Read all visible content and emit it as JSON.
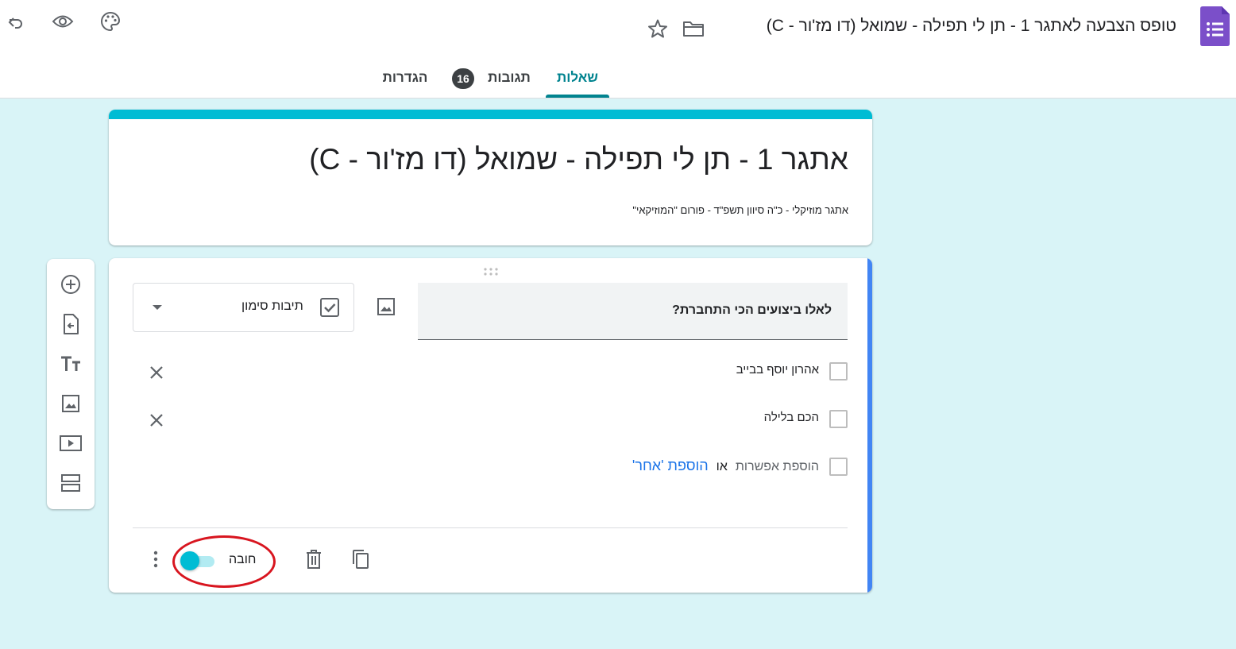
{
  "topbar": {
    "form_title": "טופס הצבעה לאתגר 1 - תן לי תפילה - שמואל (דו מז'ור - C)",
    "icons": [
      "undo-icon",
      "eye-icon",
      "palette-icon",
      "star-icon",
      "folder-icon",
      "forms-app-icon"
    ]
  },
  "tabs": [
    {
      "label": "שאלות",
      "active": true
    },
    {
      "label": "תגובות",
      "badge": "16"
    },
    {
      "label": "הגדרות"
    }
  ],
  "header": {
    "title": "אתגר 1 - תן לי תפילה - שמואל (דו מז'ור - C)",
    "description": "אתגר מוזיקלי - כ\"ה סיוון תשפ\"ד - פורום \"המוזיקאי\""
  },
  "side_toolbar": [
    "add-question-icon",
    "import-questions-icon",
    "add-title-icon",
    "add-image-icon",
    "add-video-icon",
    "add-section-icon"
  ],
  "question": {
    "title": "לאלו ביצועים הכי התחברת?",
    "type_label": "תיבות סימון",
    "options": [
      "אהרון יוסף בבייב",
      "הכם בלילה"
    ],
    "add_option_label": "הוספת אפשרות",
    "or_label": "או",
    "add_other_label": "הוספת 'אחר'",
    "required_label": "חובה",
    "required_on": true
  },
  "colors": {
    "accent": "#00bcd4",
    "tab_active": "#00838f",
    "canvas": "#d9f4f7",
    "question_accent": "#4285f4",
    "link": "#1a73e8",
    "annotation": "#d8151f",
    "app_icon": "#7b4fc9"
  }
}
